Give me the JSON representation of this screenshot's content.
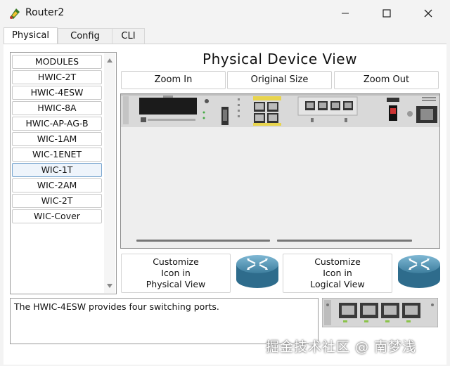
{
  "window": {
    "title": "Router2"
  },
  "tabs": [
    {
      "label": "Physical",
      "active": true
    },
    {
      "label": "Config",
      "active": false
    },
    {
      "label": "CLI",
      "active": false
    }
  ],
  "modules": {
    "items": [
      "MODULES",
      "HWIC-2T",
      "HWIC-4ESW",
      "HWIC-8A",
      "HWIC-AP-AG-B",
      "WIC-1AM",
      "WIC-1ENET",
      "WIC-1T",
      "WIC-2AM",
      "WIC-2T",
      "WIC-Cover"
    ],
    "selected": "WIC-1T"
  },
  "physical_view": {
    "title": "Physical Device View",
    "zoom_in": "Zoom In",
    "original_size": "Original Size",
    "zoom_out": "Zoom Out"
  },
  "customize": {
    "physical": {
      "line1": "Customize",
      "line2": "Icon in",
      "line3": "Physical View"
    },
    "logical": {
      "line1": "Customize",
      "line2": "Icon in",
      "line3": "Logical View"
    }
  },
  "description": "The HWIC-4ESW provides four switching ports.",
  "watermark": "掘金技术社区 @ 南梦浅",
  "colors": {
    "router_blue": "#4f93b5",
    "selected_item": "#eef4fb"
  }
}
